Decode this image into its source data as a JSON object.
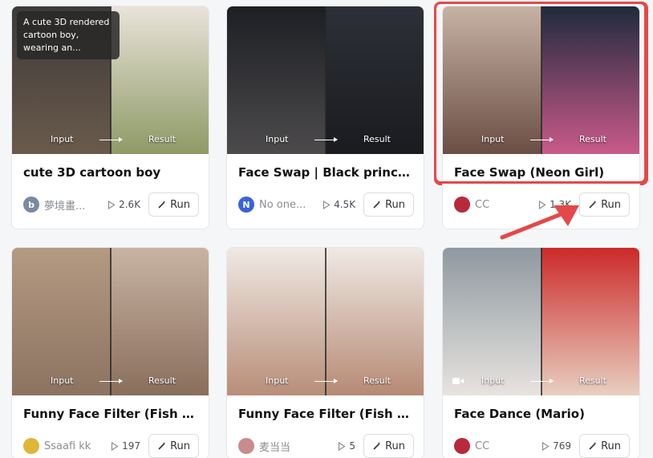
{
  "cards": [
    {
      "title": "cute 3D cartoon boy",
      "author": "夢境畫...",
      "avatar_letter": "b",
      "avatar_color": "#7a8aa3",
      "runs": "2.6K",
      "run_label": "Run",
      "input_label": "Input",
      "result_label": "Result",
      "tooltip": "A cute 3D rendered cartoon boy, wearing an...",
      "left_colors": [
        "#3d3a37",
        "#6a5a4c"
      ],
      "right_colors": [
        "#e9e3da",
        "#8e9a66"
      ]
    },
    {
      "title": "Face Swap | Black princess",
      "author": "No one...",
      "avatar_letter": "N",
      "avatar_color": "#3b63d8",
      "runs": "4.5K",
      "run_label": "Run",
      "input_label": "Input",
      "result_label": "Result",
      "left_colors": [
        "#1d1f24",
        "#4c4a4b"
      ],
      "right_colors": [
        "#2d3038",
        "#1a1b1f"
      ]
    },
    {
      "title": "Face Swap (Neon Girl)",
      "author": "CC",
      "avatar_letter": "",
      "avatar_color": "#b8293b",
      "runs": "1.3K",
      "run_label": "Run",
      "input_label": "Input",
      "result_label": "Result",
      "left_colors": [
        "#c7b2a4",
        "#6b4e45"
      ],
      "right_colors": [
        "#1f2a3c",
        "#c95a8a"
      ]
    },
    {
      "title": "Funny Face Filter (Fish Li...",
      "author": "Ssaafi kk",
      "avatar_letter": "",
      "avatar_color": "#e0b63a",
      "runs": "197",
      "run_label": "Run",
      "input_label": "Input",
      "result_label": "Result",
      "left_colors": [
        "#b49a82",
        "#8c7361"
      ],
      "right_colors": [
        "#c8b3a2",
        "#8a6e5c"
      ]
    },
    {
      "title": "Funny Face Filter (Fish Li...",
      "author": "麦当当",
      "avatar_letter": "",
      "avatar_color": "#c98c8c",
      "runs": "5",
      "run_label": "Run",
      "input_label": "Input",
      "result_label": "Result",
      "left_colors": [
        "#efe9e4",
        "#b88e78"
      ],
      "right_colors": [
        "#efe9e4",
        "#b68a74"
      ]
    },
    {
      "title": "Face Dance (Mario)",
      "author": "CC",
      "avatar_letter": "",
      "avatar_color": "#b8293b",
      "runs": "769",
      "run_label": "Run",
      "input_label": "Input",
      "result_label": "Result",
      "left_colors": [
        "#8f99a1",
        "#e7e3df"
      ],
      "right_colors": [
        "#cc2a2a",
        "#e8cfc0"
      ]
    }
  ],
  "highlight_color": "#e54848"
}
